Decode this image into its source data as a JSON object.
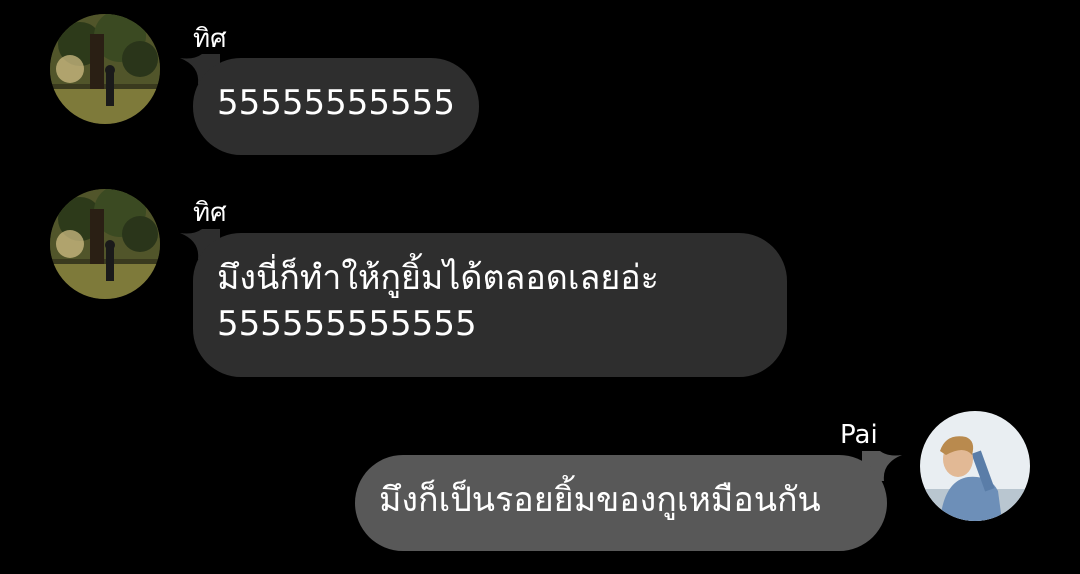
{
  "theme": {
    "background": "#000000",
    "incoming_bubble": "#2e2e2e",
    "outgoing_bubble": "#585858",
    "text": "#ffffff"
  },
  "messages": [
    {
      "direction": "incoming",
      "sender": "ทิศ",
      "avatar_icon": "profile-photo-person-under-tree",
      "lines": [
        "55555555555"
      ]
    },
    {
      "direction": "incoming",
      "sender": "ทิศ",
      "avatar_icon": "profile-photo-person-under-tree",
      "lines": [
        "มึงนี่ก็ทำให้กูยิ้มได้ตลอดเลยอ่ะ",
        "555555555555"
      ]
    },
    {
      "direction": "outgoing",
      "sender": "Pai",
      "avatar_icon": "profile-photo-person-blue-shirt",
      "lines": [
        "มึงก็เป็นรอยยิ้มของกูเหมือนกัน"
      ]
    }
  ]
}
